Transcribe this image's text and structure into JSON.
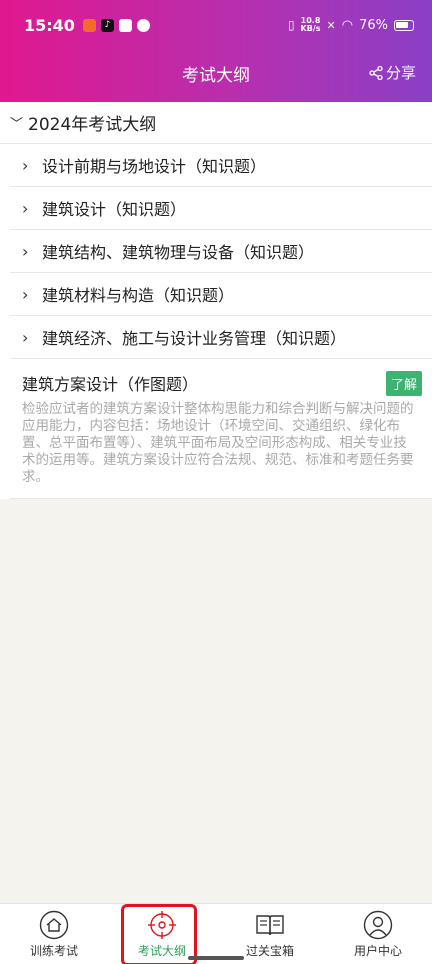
{
  "status": {
    "time": "15:40",
    "net_speed_top": "10.8",
    "net_speed_bottom": "KB/s",
    "battery": "76%"
  },
  "nav": {
    "title": "考试大纲",
    "share_label": "分享"
  },
  "outline": {
    "root_label": "2024年考试大纲",
    "items": [
      {
        "label": "设计前期与场地设计（知识题）"
      },
      {
        "label": "建筑设计（知识题）"
      },
      {
        "label": "建筑结构、建筑物理与设备（知识题）"
      },
      {
        "label": "建筑材料与构造（知识题）"
      },
      {
        "label": "建筑经济、施工与设计业务管理（知识题）"
      }
    ],
    "detail": {
      "title": "建筑方案设计（作图题）",
      "button": "了解",
      "description": "检验应试者的建筑方案设计整体构思能力和综合判断与解决问题的应用能力，内容包括：场地设计（环境空间、交通组织、绿化布置、总平面布置等）、建筑平面布局及空间形态构成、相关专业技术的运用等。建筑方案设计应符合法规、规范、标准和考题任务要求。"
    }
  },
  "tabs": [
    {
      "label": "训练考试",
      "icon": "home-icon"
    },
    {
      "label": "考试大纲",
      "icon": "target-icon"
    },
    {
      "label": "过关宝箱",
      "icon": "book-icon"
    },
    {
      "label": "用户中心",
      "icon": "user-icon"
    }
  ],
  "colors": {
    "header_start": "#e0188f",
    "header_end": "#8a3fc7",
    "active_tab": "#2e9e57",
    "learn_button": "#3cb371",
    "highlight": "#e0141e"
  }
}
